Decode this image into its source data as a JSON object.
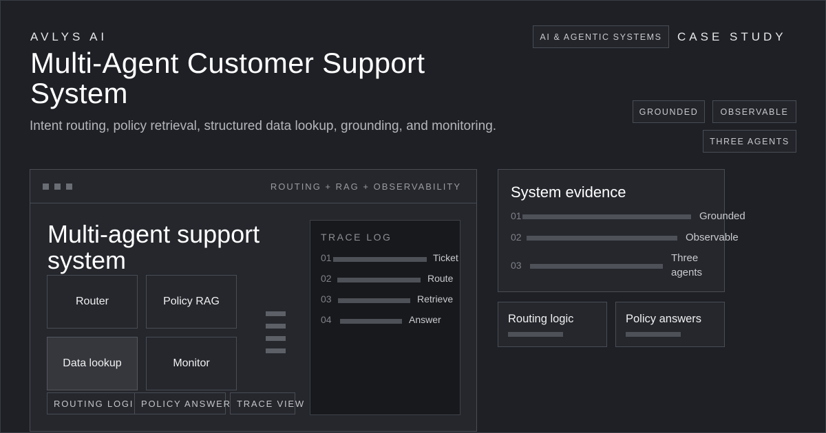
{
  "header": {
    "brand": "AVLYS AI",
    "title": "Multi-Agent Customer Support System",
    "subtitle": "Intent routing, policy retrieval, structured data lookup, grounding, and monitoring.",
    "category_tag": "AI & AGENTIC SYSTEMS",
    "case_study": "CASE STUDY",
    "tags": [
      "GROUNDED",
      "OBSERVABLE",
      "THREE AGENTS"
    ]
  },
  "window": {
    "caption": "ROUTING + RAG + OBSERVABILITY",
    "title": "Multi-agent support system",
    "agents": [
      "Router",
      "Policy RAG",
      "Data lookup",
      "Monitor"
    ],
    "active_agent": "Data lookup",
    "chips": [
      "ROUTING LOGIC",
      "POLICY ANSWERS",
      "TRACE VIEW"
    ],
    "trace": {
      "title": "TRACE LOG",
      "rows": [
        {
          "num": "01",
          "label": "Ticket"
        },
        {
          "num": "02",
          "label": "Route"
        },
        {
          "num": "03",
          "label": "Retrieve"
        },
        {
          "num": "04",
          "label": "Answer"
        }
      ]
    }
  },
  "evidence": {
    "title": "System evidence",
    "rows": [
      {
        "num": "01",
        "label": "Grounded"
      },
      {
        "num": "02",
        "label": "Observable"
      },
      {
        "num": "03",
        "label": "Three agents"
      }
    ]
  },
  "cards": [
    "Routing logic",
    "Policy answers"
  ],
  "colors": {
    "background": "#1e2026",
    "panel": "#25272d",
    "border": "#4a4d55",
    "trace_bg": "#18191d"
  }
}
